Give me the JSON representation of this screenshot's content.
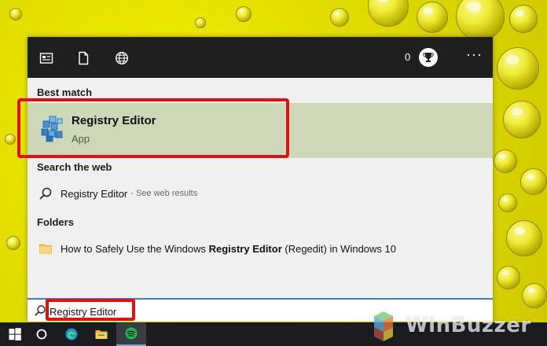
{
  "panel": {
    "points_count": "0",
    "more_label": "···",
    "best_match_header": "Best match",
    "best_match": {
      "title": "Registry Editor",
      "subtitle": "App"
    },
    "web_header": "Search the web",
    "web_result": {
      "term": "Registry Editor",
      "suffix": "- See web results"
    },
    "folders_header": "Folders",
    "folder_result": {
      "prefix": "How to Safely Use the Windows ",
      "bold": "Registry Editor",
      "suffix": " (Regedit) in Windows 10"
    }
  },
  "search": {
    "value": "Registry Editor"
  },
  "icons": {
    "top": [
      "documents-panel-icon",
      "document-icon",
      "globe-icon"
    ],
    "taskbar": [
      "windows-start-icon",
      "cortana-icon",
      "edge-icon",
      "file-explorer-icon",
      "spotify-icon"
    ]
  },
  "colors": {
    "highlight_red": "#e01010",
    "best_match_bg": "#cdd8b8",
    "panel_top": "#1f1f1f",
    "taskbar": "#1a1c20",
    "spotify_green": "#1db954"
  },
  "watermark": {
    "text": "WinBuzzer"
  }
}
